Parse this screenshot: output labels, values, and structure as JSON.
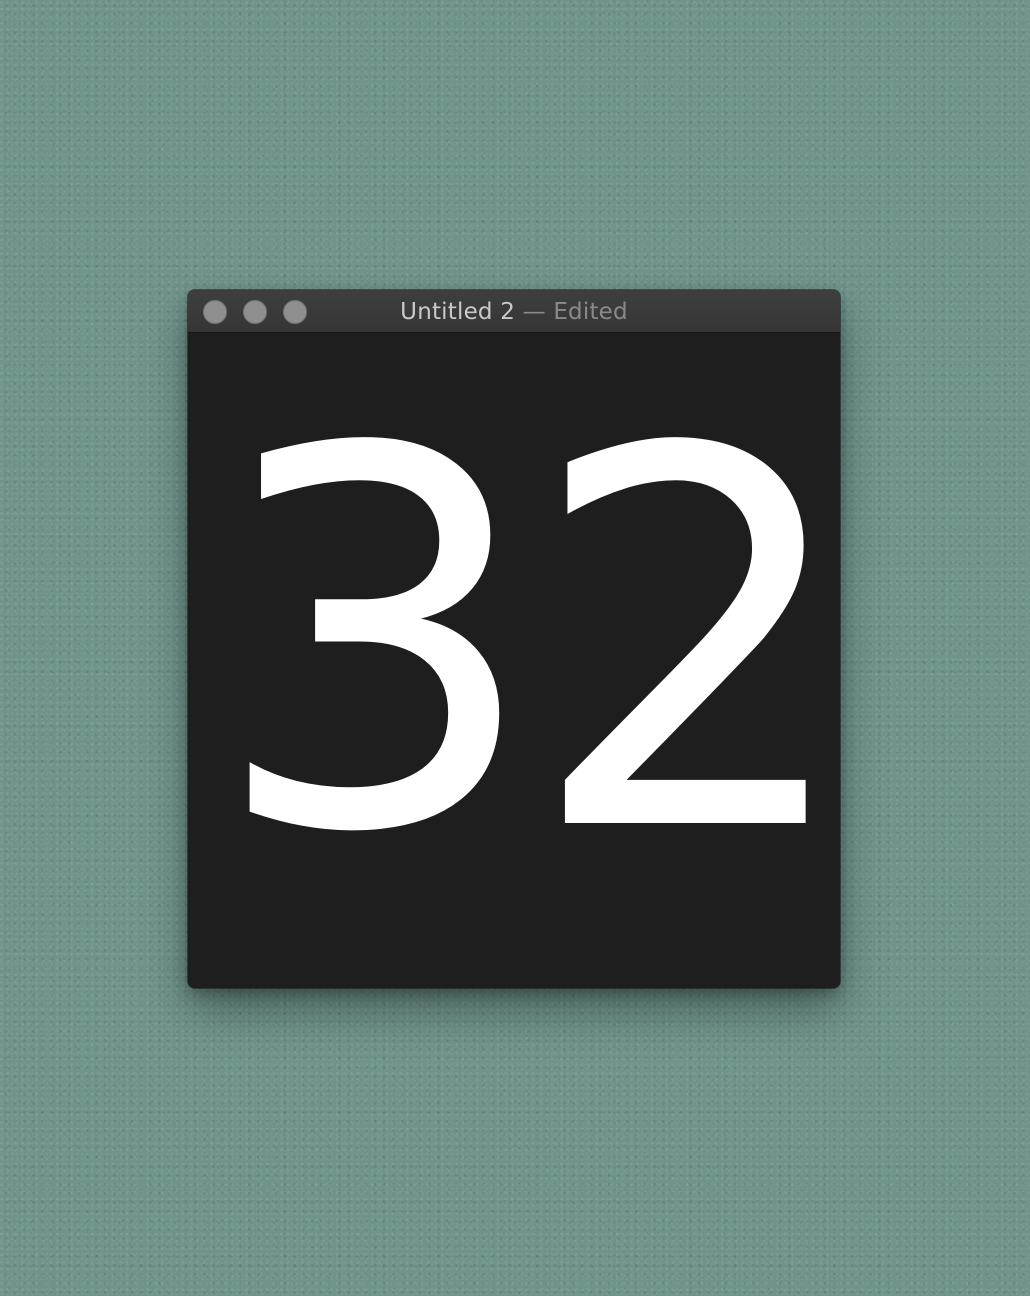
{
  "window": {
    "title": "Untitled 2",
    "separator": " — ",
    "status": "Edited"
  },
  "content": {
    "number_text": "32"
  },
  "colors": {
    "desktop": "#6f948b",
    "window_background": "#1e1e1e",
    "titlebar": "#3a3a3a",
    "traffic_light": "#8f8f8f",
    "number": "#ffffff"
  },
  "icons": {
    "close": "close-button-icon",
    "minimize": "minimize-button-icon",
    "zoom": "zoom-button-icon"
  }
}
